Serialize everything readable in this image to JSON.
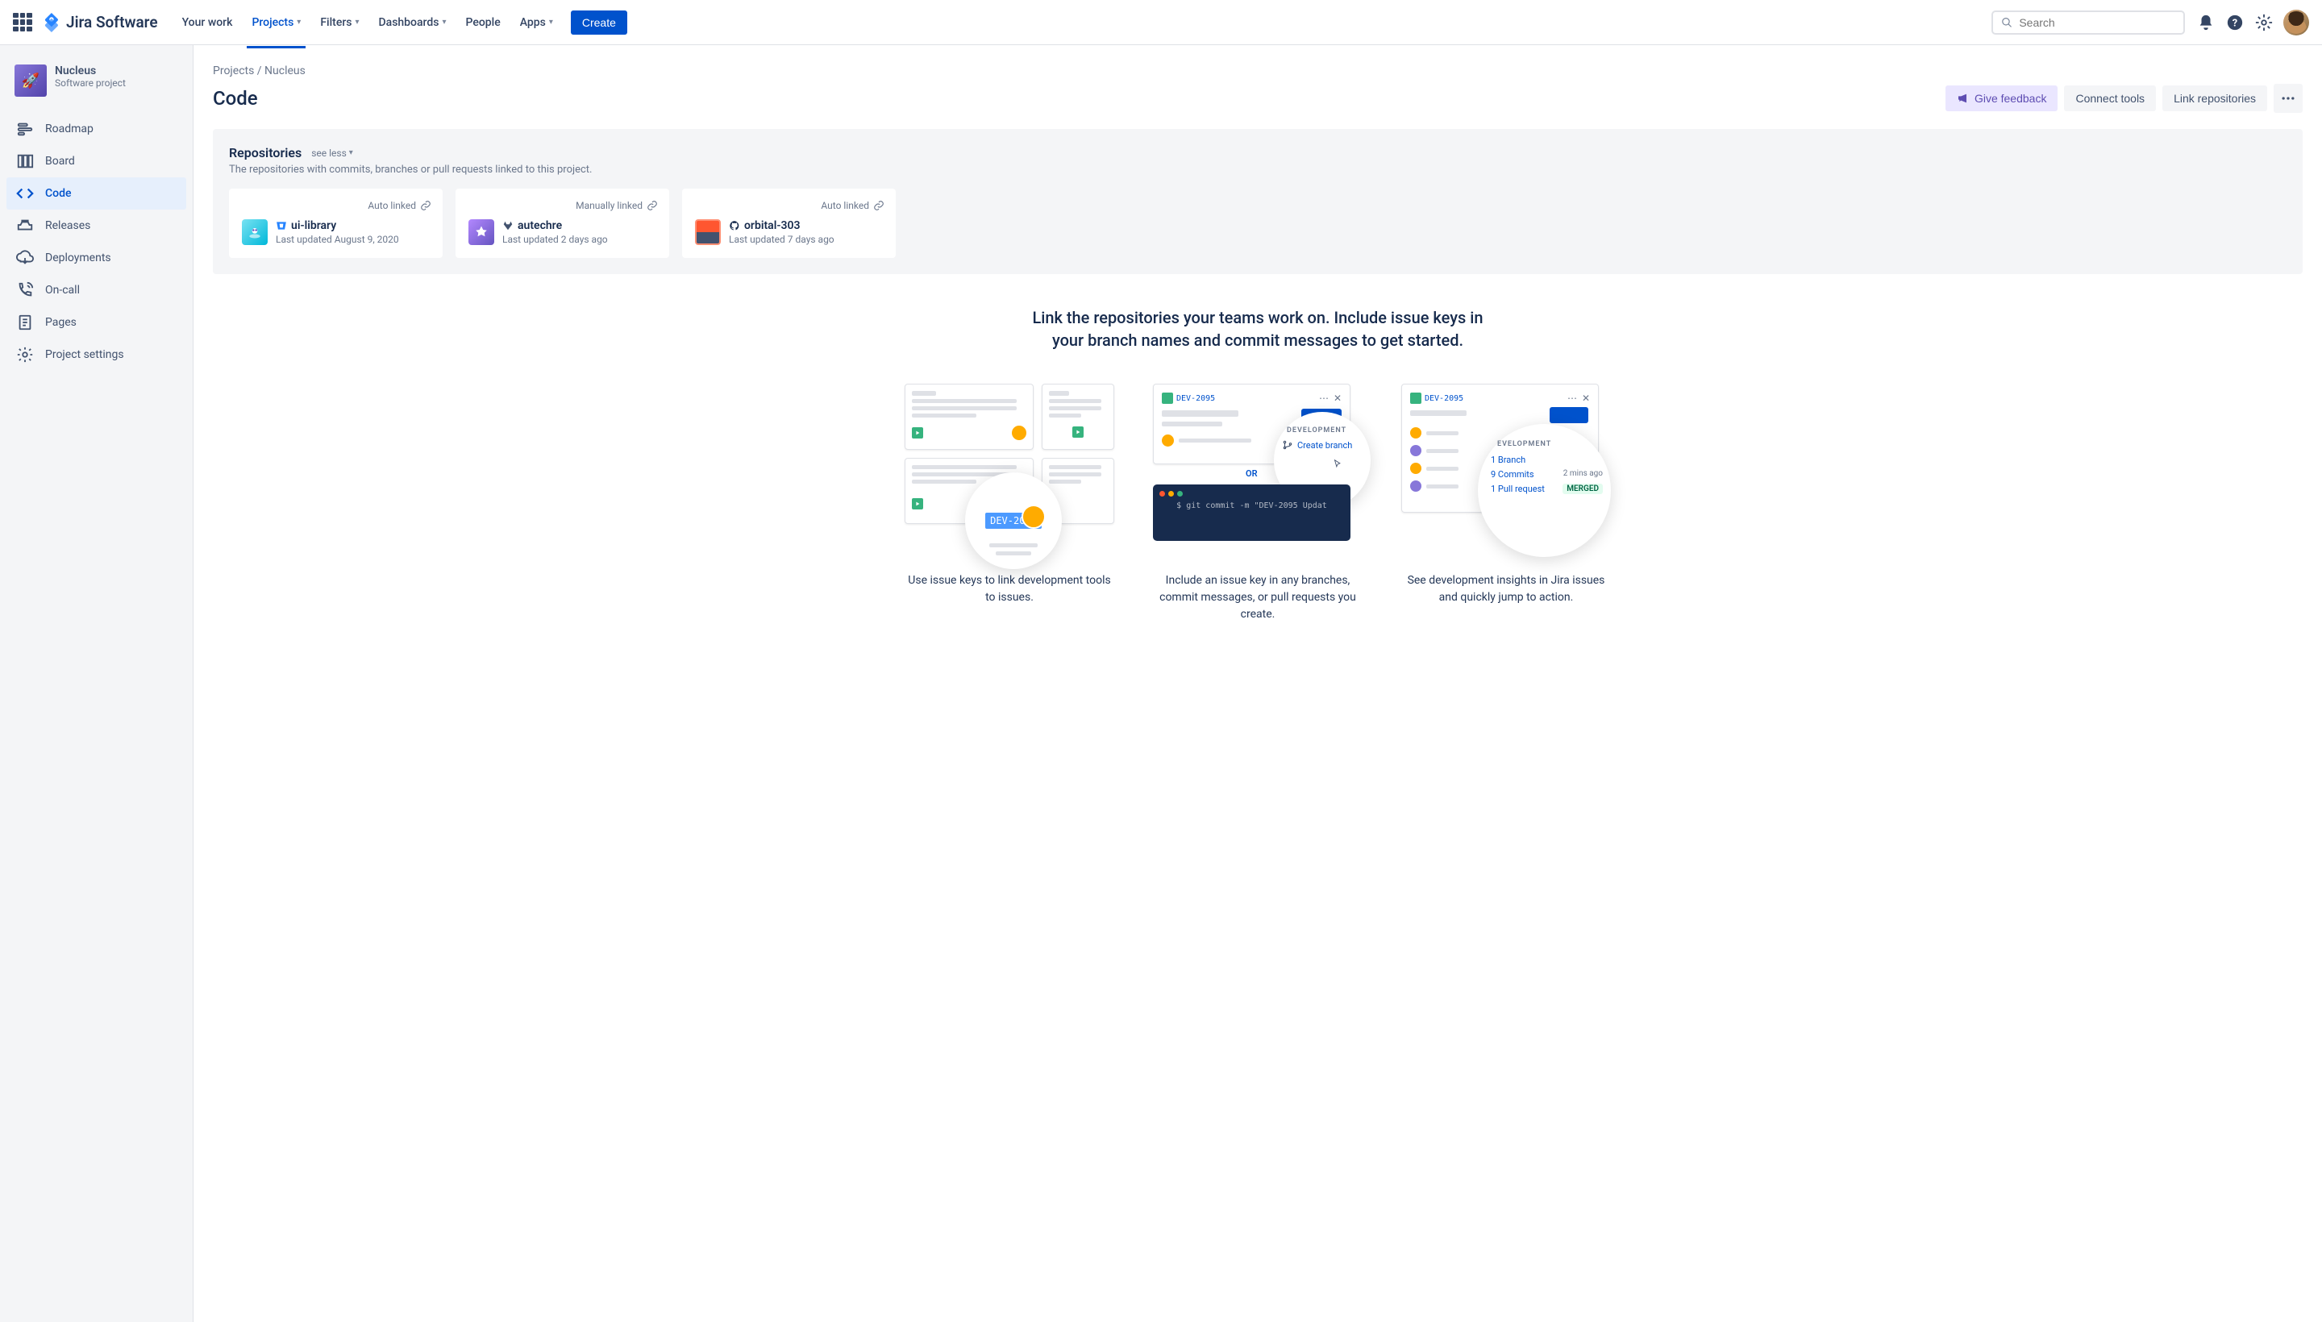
{
  "topnav": {
    "logo": "Jira Software",
    "items": [
      "Your work",
      "Projects",
      "Filters",
      "Dashboards",
      "People",
      "Apps"
    ],
    "active_index": 1,
    "has_dropdown": [
      false,
      true,
      true,
      true,
      false,
      true
    ],
    "create": "Create",
    "search_placeholder": "Search"
  },
  "sidebar": {
    "project_name": "Nucleus",
    "project_type": "Software project",
    "items": [
      {
        "label": "Roadmap",
        "icon": "roadmap"
      },
      {
        "label": "Board",
        "icon": "board"
      },
      {
        "label": "Code",
        "icon": "code"
      },
      {
        "label": "Releases",
        "icon": "releases"
      },
      {
        "label": "Deployments",
        "icon": "deployments"
      },
      {
        "label": "On-call",
        "icon": "oncall"
      },
      {
        "label": "Pages",
        "icon": "pages"
      },
      {
        "label": "Project settings",
        "icon": "settings"
      }
    ],
    "active_index": 2
  },
  "breadcrumb": "Projects / Nucleus",
  "page_title": "Code",
  "actions": {
    "feedback": "Give feedback",
    "connect": "Connect tools",
    "link_repos": "Link repositories"
  },
  "repos": {
    "title": "Repositories",
    "see_less": "see less",
    "subtitle": "The repositories with commits, branches or pull requests linked to this project.",
    "cards": [
      {
        "link_type": "Auto linked",
        "name": "ui-library",
        "updated": "Last updated August 9, 2020",
        "provider": "bitbucket"
      },
      {
        "link_type": "Manually linked",
        "name": "autechre",
        "updated": "Last updated 2 days ago",
        "provider": "gitlab"
      },
      {
        "link_type": "Auto linked",
        "name": "orbital-303",
        "updated": "Last updated 7 days ago",
        "provider": "github"
      }
    ]
  },
  "onboard": {
    "heading": "Link the repositories your teams work on. Include issue keys in your branch names and commit messages to get started.",
    "captions": [
      "Use issue keys to link development tools to issues.",
      "Include an issue key in any branches, commit messages, or pull requests you create.",
      "See development insights in Jira issues and quickly jump to action."
    ],
    "illus1": {
      "issue_key": "DEV-2095"
    },
    "illus2": {
      "issue_key": "DEV-2095",
      "dev_heading": "DEVELOPMENT",
      "create_branch": "Create branch",
      "or": "OR",
      "terminal": "$ git commit -m \"DEV-2095 Updat"
    },
    "illus3": {
      "issue_key": "DEV-2095",
      "dev_heading": "EVELOPMENT",
      "branch": "1 Branch",
      "commits": "9 Commits",
      "commits_time": "2 mins ago",
      "pr": "1 Pull request",
      "merged": "MERGED"
    }
  }
}
